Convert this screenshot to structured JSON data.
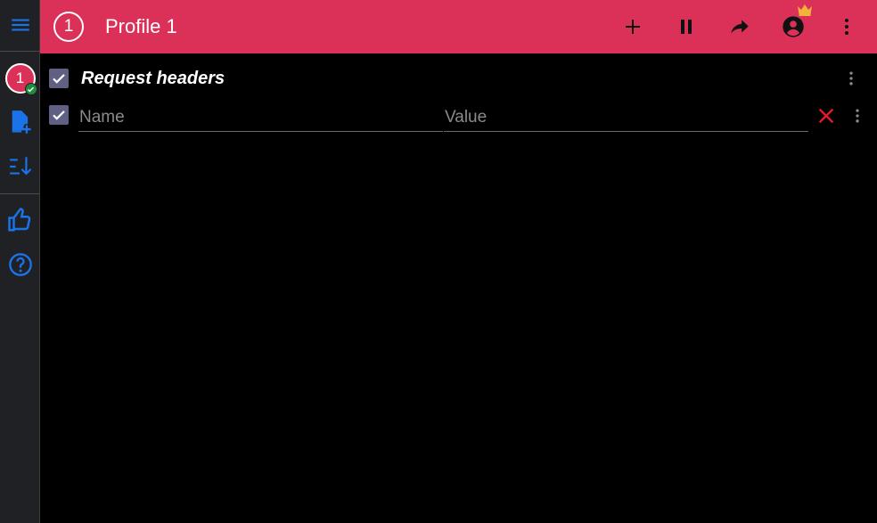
{
  "colors": {
    "brand": "#db3159",
    "sidebar_bg": "#202124",
    "accent_blue": "#1a73e8",
    "success": "#1e8e3e",
    "delete_red": "#e8192c",
    "crown": "#f2b33d"
  },
  "sidebar": {
    "profile_number": "1",
    "icons": [
      "menu-icon",
      "add-file-icon",
      "sort-icon",
      "thumb-up-icon",
      "help-icon"
    ]
  },
  "topbar": {
    "profile_number": "1",
    "title": "Profile 1",
    "actions": [
      "add-icon",
      "pause-icon",
      "share-icon",
      "account-icon",
      "more-vert-icon"
    ]
  },
  "section": {
    "title": "Request headers",
    "enabled": true
  },
  "header_row": {
    "enabled": true,
    "name_value": "",
    "name_placeholder": "Name",
    "value_value": "",
    "value_placeholder": "Value"
  }
}
